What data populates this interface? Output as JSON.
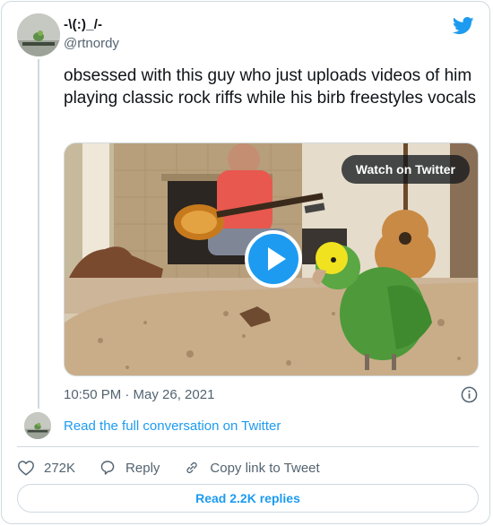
{
  "author": {
    "display_name": "-\\(:)_/-",
    "handle": "@rtnordy"
  },
  "tweet": {
    "text": "obsessed with this guy who just uploads videos of him playing classic rock riffs while his birb freestyles vocals",
    "timestamp": "10:50 PM · May 26, 2021"
  },
  "media": {
    "watch_label": "Watch on Twitter",
    "play_icon": "play-icon"
  },
  "conversation": {
    "read_full_label": "Read the full conversation on Twitter"
  },
  "actions": {
    "likes": "272K",
    "reply_label": "Reply",
    "copy_link_label": "Copy link to Tweet"
  },
  "replies_button": "Read 2.2K replies",
  "colors": {
    "accent": "#1d9bf0",
    "text": "#0f1419",
    "muted": "#536471",
    "border": "#cfd9de"
  }
}
